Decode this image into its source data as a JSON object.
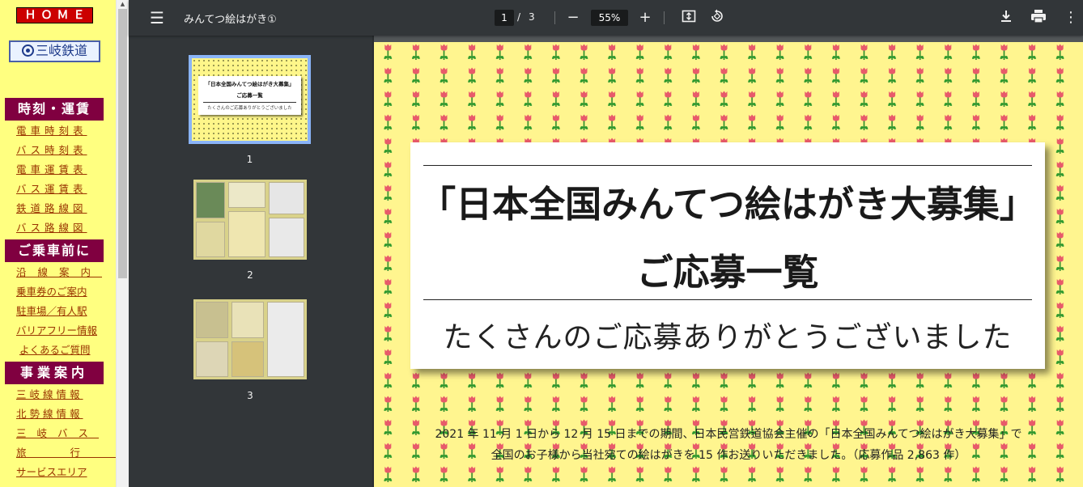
{
  "sidebar": {
    "home_label": "ＨＯＭＥ",
    "logo_text": "三岐鉄道",
    "sections": [
      {
        "title": "時刻・運賃",
        "links": [
          "電車時刻表",
          "バス時刻表",
          "電車運賃表",
          "バス運賃表",
          "鉄道路線図",
          "バス路線図"
        ]
      },
      {
        "title": "ご乗車前に",
        "links": [
          "沿線案内",
          "乗車券のご案内",
          "駐車場／有人駅",
          "バリアフリー情報",
          "よくあるご質問"
        ]
      },
      {
        "title": "事業案内",
        "links": [
          "三岐線情報",
          "北勢線情報",
          "三岐バス",
          "旅行",
          "サービスエリア"
        ]
      }
    ]
  },
  "toolbar": {
    "menu_icon": "menu-icon",
    "title": "みんてつ絵はがき①",
    "current_page": "1",
    "page_separator": "/",
    "total_pages": "3",
    "zoom": "55%",
    "icons": [
      "zoom-out-icon",
      "zoom-in-icon",
      "fit-page-icon",
      "rotate-icon",
      "download-icon",
      "print-icon",
      "more-icon"
    ]
  },
  "thumbnails": [
    {
      "number": "1",
      "selected": true,
      "title": "「日本全国みんてつ絵はがき大募集」",
      "subtitle": "ご応募一覧",
      "message": "たくさんのご応募ありがとうございました"
    },
    {
      "number": "2",
      "selected": false
    },
    {
      "number": "3",
      "selected": false
    }
  ],
  "page": {
    "background_color": "#fff58f",
    "title": "「日本全国みんてつ絵はがき大募集」",
    "subtitle": "ご応募一覧",
    "message": "たくさんのご応募ありがとうございました",
    "body_line_1": "2021 年 11 月 1 日から 12 月 15 日までの期間、日本民営鉄道協会主催の「日本全国みんてつ絵はがき大募集」で",
    "body_line_2": "全国のお子様から当社宛ての絵はがきを 15 作お送りいただきました。（応募作品 2,863 作）"
  }
}
